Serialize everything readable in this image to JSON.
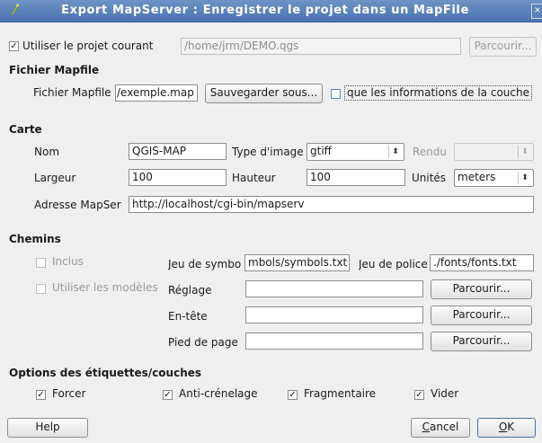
{
  "window": {
    "title": "Export MapServer : Enregistrer le projet dans un MapFile",
    "close_glyph": "×"
  },
  "project": {
    "use_current_label": "Utiliser le projet courant",
    "use_current_checked": "✓",
    "path_value": "/home/jrm/DEMO.qgs",
    "browse_label": "Parcourir..."
  },
  "mapfile": {
    "section": "Fichier Mapfile",
    "label": "Fichier Mapfile",
    "value": "/exemple.map",
    "save_as_label": "Sauvegarder sous...",
    "layer_info_label": "que les informations de la couche"
  },
  "carte": {
    "section": "Carte",
    "name_label": "Nom",
    "name_value": "QGIS-MAP",
    "image_type_label": "Type d'image",
    "image_type_value": "gtiff",
    "render_label": "Rendu",
    "render_value": "",
    "width_label": "Largeur",
    "width_value": "100",
    "height_label": "Hauteur",
    "height_value": "100",
    "units_label": "Unités",
    "units_value": "meters",
    "address_label": "Adresse MapSer",
    "address_value": "http://localhost/cgi-bin/mapserv"
  },
  "chemins": {
    "section": "Chemins",
    "included_label": "Inclus",
    "use_templates_label": "Utiliser les modèles",
    "symbols_label": "Jeu de symbo",
    "symbols_value": "mbols/symbols.txt",
    "fonts_label": "Jeu de police",
    "fonts_value": "./fonts/fonts.txt",
    "template_label": "Réglage",
    "template_value": "",
    "header_label": "En-tête",
    "header_value": "",
    "footer_label": "Pied de page",
    "footer_value": "",
    "browse_label": "Parcourir..."
  },
  "options": {
    "section": "Options des étiquettes/couches",
    "check_glyph": "✓",
    "force_label": "Forcer",
    "antialias_label": "Anti-crénelage",
    "partials_label": "Fragmentaire",
    "empty_label": "Vider"
  },
  "footer": {
    "help_label": "Help",
    "cancel_prefix": "C",
    "cancel_rest": "ancel",
    "ok_prefix": "O",
    "ok_rest": "K"
  }
}
